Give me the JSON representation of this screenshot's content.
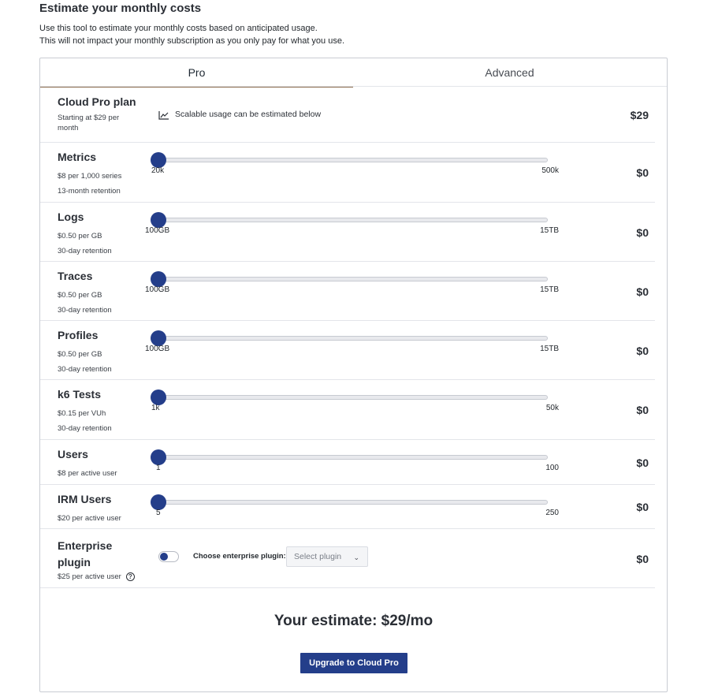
{
  "page": {
    "heading": "Estimate your monthly costs",
    "intro_line1": "Use this tool to estimate your monthly costs based on anticipated usage.",
    "intro_line2": "This will not impact your monthly subscription as you only pay for what you use."
  },
  "tabs": [
    {
      "label": "Pro",
      "selected": true
    },
    {
      "label": "Advanced",
      "selected": false
    }
  ],
  "plan": {
    "name": "Cloud Pro plan",
    "sub1": "Starting at $29 per",
    "sub2": "month",
    "scalable_note": "Scalable usage can be estimated below",
    "price": "$29"
  },
  "sliders": [
    {
      "name": "Metrics",
      "sub1": "$8 per 1,000 series",
      "sub2": "13-month retention",
      "min": "20k",
      "max": "500k",
      "level": 0,
      "price": "$0"
    },
    {
      "name": "Logs",
      "sub1": "$0.50 per GB",
      "sub2": "30-day retention",
      "min": "100GB",
      "max": "15TB",
      "level": 0,
      "price": "$0"
    },
    {
      "name": "Traces",
      "sub1": "$0.50 per GB",
      "sub2": "30-day retention",
      "min": "100GB",
      "max": "15TB",
      "level": 0,
      "price": "$0"
    },
    {
      "name": "Profiles",
      "sub1": "$0.50 per GB",
      "sub2": "30-day retention",
      "min": "100GB",
      "max": "15TB",
      "level": 0,
      "price": "$0"
    },
    {
      "name": "k6 Tests",
      "sub1": "$0.15 per VUh",
      "sub2": "30-day retention",
      "min": "1k",
      "max": "50k",
      "level": 0,
      "price": "$0"
    },
    {
      "name": "Users",
      "sub1": "$8 per active user",
      "sub2": "",
      "min": "1",
      "max": "100",
      "level": 0,
      "price": "$0"
    },
    {
      "name": "IRM Users",
      "sub1": "$20 per active user",
      "sub2": "",
      "min": "5",
      "max": "250",
      "level": 0,
      "price": "$0"
    }
  ],
  "enterprise": {
    "name1": "Enterprise",
    "name2": "plugin",
    "sub": "$25 per active user",
    "toggle_on": false,
    "plugin_label": "Choose enterprise plugin:",
    "select_placeholder": "Select plugin",
    "price": "$0"
  },
  "estimate": {
    "text": "Your estimate: $29/mo",
    "button": "Upgrade to Cloud Pro"
  },
  "colors": {
    "accent": "#243e8a",
    "tab_underline": "#8a6b4b",
    "border": "#c9ccd3"
  }
}
